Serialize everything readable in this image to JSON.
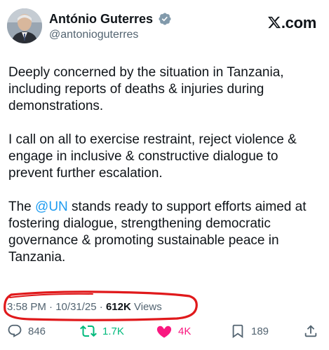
{
  "author": {
    "name": "António Guterres",
    "handle": "@antonioguterres"
  },
  "site": {
    "logo_suffix": ".com"
  },
  "tweet": {
    "p1": "Deeply concerned by the situation in Tanzania, including reports of deaths & injuries during demonstrations.",
    "p2": "I call on all to exercise restraint, reject violence & engage in inclusive & constructive dialogue to prevent further escalation.",
    "p3_mention": "@UN",
    "p3_rest": " stands ready to support efforts aimed at fostering dialogue, strengthening democratic governance & promoting sustainable peace in Tanzania.",
    "p3_prefix": "The "
  },
  "meta": {
    "time": "3:58 PM",
    "sep1": " · ",
    "date": "10/31/25",
    "sep2": " · ",
    "views_count": "612K",
    "views_label": " Views"
  },
  "actions": {
    "replies": "846",
    "reposts": "1.7K",
    "likes": "4K",
    "bookmarks": "189"
  },
  "colors": {
    "accent": "#1d9bf0",
    "repost": "#00ba7c",
    "like": "#f91880",
    "annotation": "#e0191b"
  },
  "icons": [
    "verified-badge-icon",
    "x-logo-icon",
    "reply-icon",
    "repost-icon",
    "like-icon",
    "bookmark-icon",
    "share-icon"
  ]
}
